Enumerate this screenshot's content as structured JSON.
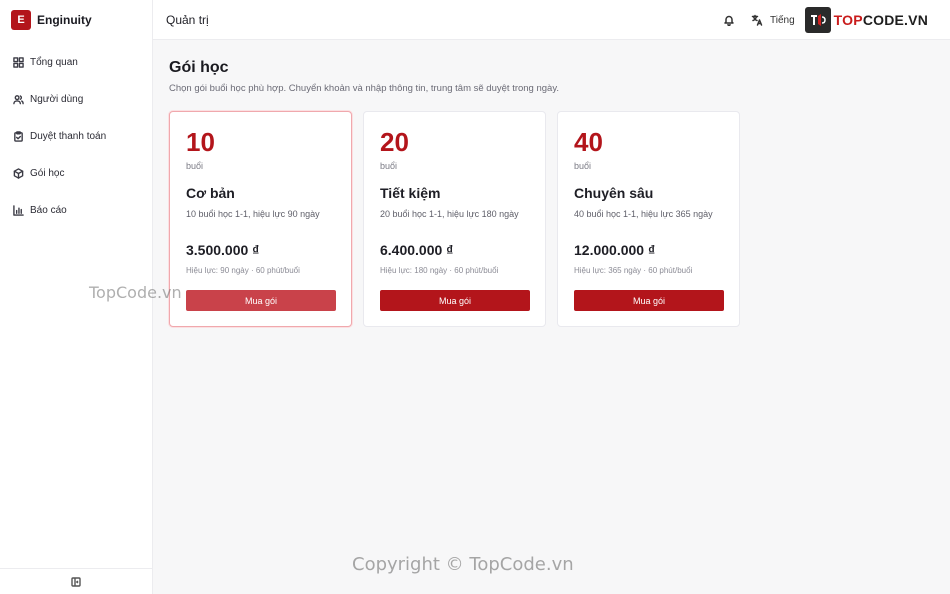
{
  "brand": {
    "logo_letter": "E",
    "name": "Enginuity"
  },
  "sidebar": {
    "items": [
      {
        "label": "Tổng quan",
        "icon": "grid-icon"
      },
      {
        "label": "Người dùng",
        "icon": "users-icon"
      },
      {
        "label": "Duyệt thanh toán",
        "icon": "clipboard-check-icon"
      },
      {
        "label": "Gói học",
        "icon": "package-icon"
      },
      {
        "label": "Báo cáo",
        "icon": "bar-chart-icon"
      }
    ],
    "collapse_icon": "sidebar-collapse-icon"
  },
  "topbar": {
    "title": "Quản trị",
    "language": "Tiếng",
    "watermark_logo": {
      "part1": "TOP",
      "part2": "CODE.VN"
    }
  },
  "main": {
    "title": "Gói học",
    "subtitle": "Chọn gói buổi học phù hợp. Chuyển khoản và nhập thông tin, trung tâm sẽ duyệt trong ngày.",
    "packages": [
      {
        "count": "10",
        "unit": "buổi",
        "name": "Cơ bản",
        "description": "10 buổi học 1-1, hiệu lực 90 ngày",
        "price": "3.500.000 ₫",
        "meta": "Hiệu lực: 90 ngày · 60 phút/buổi",
        "button": "Mua gói"
      },
      {
        "count": "20",
        "unit": "buổi",
        "name": "Tiết kiệm",
        "description": "20 buổi học 1-1, hiệu lực 180 ngày",
        "price": "6.400.000 ₫",
        "meta": "Hiệu lực: 180 ngày · 60 phút/buổi",
        "button": "Mua gói"
      },
      {
        "count": "40",
        "unit": "buổi",
        "name": "Chuyên sâu",
        "description": "40 buổi học 1-1, hiệu lực 365 ngày",
        "price": "12.000.000 ₫",
        "meta": "Hiệu lực: 365 ngày · 60 phút/buổi",
        "button": "Mua gói"
      }
    ]
  },
  "watermarks": {
    "middle": "TopCode.vn",
    "bottom": "Copyright © TopCode.vn"
  },
  "colors": {
    "accent": "#b3151b",
    "highlight_border": "#f0a8ad"
  }
}
